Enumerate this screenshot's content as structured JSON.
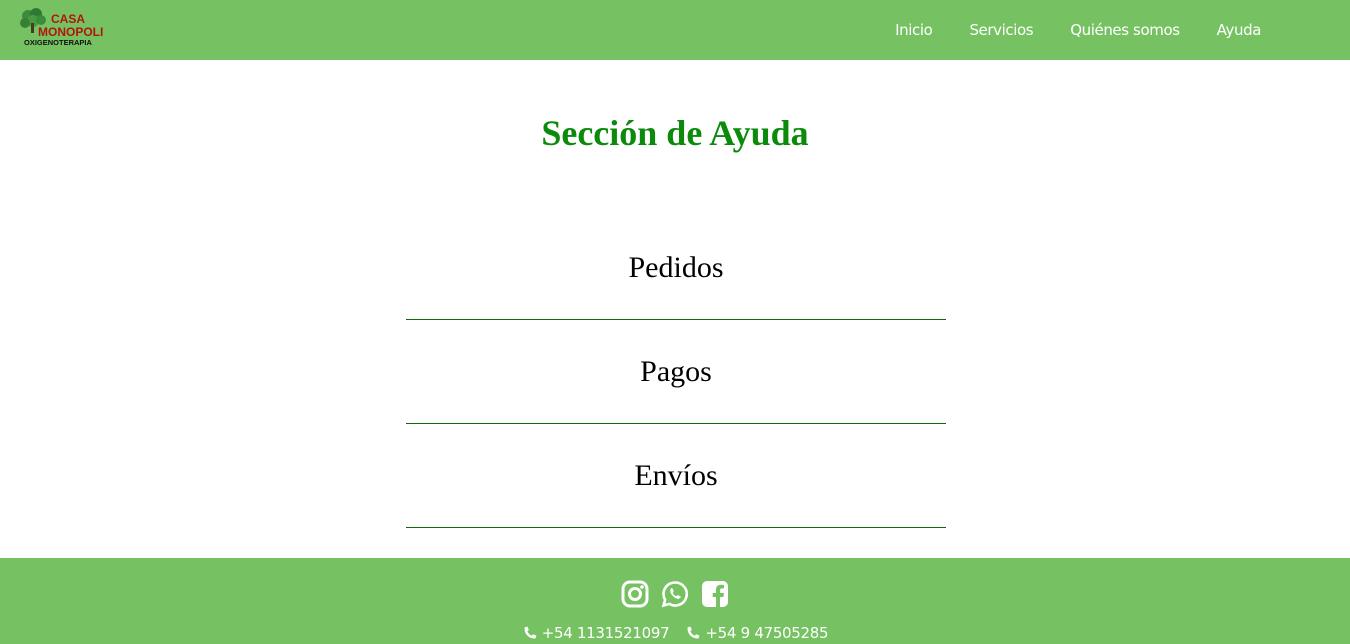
{
  "header": {
    "logo": {
      "line1": "CASA",
      "line2": "MONOPOLI",
      "line3": "OXIGENOTERAPIA"
    },
    "nav": [
      {
        "label": "Inicio"
      },
      {
        "label": "Servicios"
      },
      {
        "label": "Quiénes somos"
      },
      {
        "label": "Ayuda"
      }
    ]
  },
  "main": {
    "title": "Sección de Ayuda",
    "items": [
      {
        "label": "Pedidos"
      },
      {
        "label": "Pagos"
      },
      {
        "label": "Envíos"
      }
    ]
  },
  "footer": {
    "socials": [
      "instagram-icon",
      "whatsapp-icon",
      "facebook-icon"
    ],
    "phones": [
      "+54 1131521097",
      "+54 9 47505285"
    ]
  },
  "colors": {
    "bar": "#76c262",
    "title": "#0b8a0b",
    "divider": "#0b6b0b"
  }
}
